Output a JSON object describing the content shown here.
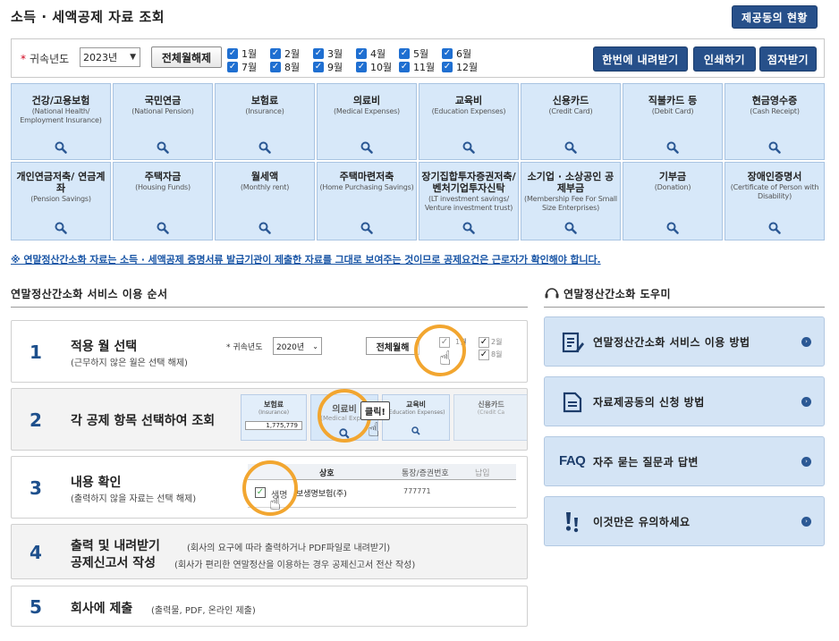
{
  "header": {
    "title": "소득 · 세액공제 자료 조회",
    "status_button": "제공동의 현황"
  },
  "filter": {
    "year_label": "귀속년도",
    "year_value": "2023년",
    "release_all": "전체월해제",
    "months": [
      "1월",
      "2월",
      "3월",
      "4월",
      "5월",
      "6월",
      "7월",
      "8월",
      "9월",
      "10월",
      "11월",
      "12월"
    ],
    "download_all": "한번에 내려받기",
    "print": "인쇄하기",
    "receive": "점자받기"
  },
  "categories": [
    {
      "ko": "건강/고용보험",
      "en": "(National Health/ Employment Insurance)"
    },
    {
      "ko": "국민연금",
      "en": "(National Pension)"
    },
    {
      "ko": "보험료",
      "en": "(Insurance)"
    },
    {
      "ko": "의료비",
      "en": "(Medical Expenses)"
    },
    {
      "ko": "교육비",
      "en": "(Education Expenses)"
    },
    {
      "ko": "신용카드",
      "en": "(Credit Card)"
    },
    {
      "ko": "직불카드 등",
      "en": "(Debit Card)"
    },
    {
      "ko": "현금영수증",
      "en": "(Cash Receipt)"
    },
    {
      "ko": "개인연금저축/ 연금계좌",
      "en": "(Pension Savings)"
    },
    {
      "ko": "주택자금",
      "en": "(Housing Funds)"
    },
    {
      "ko": "월세액",
      "en": "(Monthly rent)"
    },
    {
      "ko": "주택마련저축",
      "en": "(Home Purchasing Savings)"
    },
    {
      "ko": "장기집합투자증권저축/ 벤처기업투자신탁",
      "en": "(LT investment savings/ Venture investment trust)"
    },
    {
      "ko": "소기업 · 소상공인 공제부금",
      "en": "(Membership Fee For Small Size Enterprises)"
    },
    {
      "ko": "기부금",
      "en": "(Donation)"
    },
    {
      "ko": "장애인증명서",
      "en": "(Certificate of Person with Disability)"
    }
  ],
  "notice": "※ 연말정산간소화 자료는 소득 · 세액공제 증명서류 발급기관이 제출한 자료를 그대로 보여주는 것이므로 공제요건은 근로자가 확인해야 합니다.",
  "steps_section": {
    "title": "연말정산간소화 서비스 이용 순서",
    "steps": [
      {
        "num": "1",
        "main": "적용 월 선택",
        "sub": "(근무하지 않은 월은 선택 해제)"
      },
      {
        "num": "2",
        "main": "각 공제 항목 선택하여 조회",
        "sub": ""
      },
      {
        "num": "3",
        "main": "내용 확인",
        "sub": "(출력하지 않을 자료는 선택 해제)"
      },
      {
        "num": "4",
        "main": "출력 및 내려받기",
        "main2": "공제신고서 작성",
        "sub": "(회사의 요구에 따라 출력하거나 PDF파일로 내려받기)",
        "sub2": "(회사가 편리한 연말정산을 이용하는 경우 공제신고서 전산 작성)"
      },
      {
        "num": "5",
        "main": "회사에 제출",
        "sub": "(출력물, PDF, 온라인 제출)"
      }
    ],
    "illus1": {
      "year_label": "귀속년도",
      "year_value": "2020년",
      "release": "전체월해",
      "m1": "1월",
      "m2": "2월",
      "m8": "8월"
    },
    "illus2": {
      "insurance": "보험료",
      "insurance_en": "(Insurance)",
      "amount": "1,775,779",
      "medical": "의료비",
      "medical_en": "(Medical Expen",
      "click": "클릭!",
      "education": "교육비",
      "education_en": "(Education Expenses)",
      "credit": "신용카드",
      "credit_en": "(Credit Ca"
    },
    "illus3": {
      "col1": "상호",
      "col2": "통장/증권번호",
      "col3": "납입",
      "row_name": "생명",
      "row_company": "보생명보험(주)",
      "row_num": "777771"
    }
  },
  "helper_section": {
    "title": "연말정산간소화 도우미",
    "items": [
      {
        "label": "연말정산간소화 서비스 이용 방법",
        "icon": "document-edit-icon"
      },
      {
        "label": "자료제공동의 신청 방법",
        "icon": "document-icon"
      },
      {
        "label": "자주 묻는 질문과 답변",
        "icon": "faq-icon",
        "badge": "FAQ"
      },
      {
        "label": "이것만은 유의하세요",
        "icon": "exclamation-icon"
      }
    ]
  },
  "colors": {
    "navy_button": "#27508a",
    "category_bg": "#d7e8f9",
    "notice": "#1a56a6",
    "step_number": "#1d4f8c",
    "highlight_ring": "#f2a630",
    "helper_bg": "#d4e4f5"
  }
}
